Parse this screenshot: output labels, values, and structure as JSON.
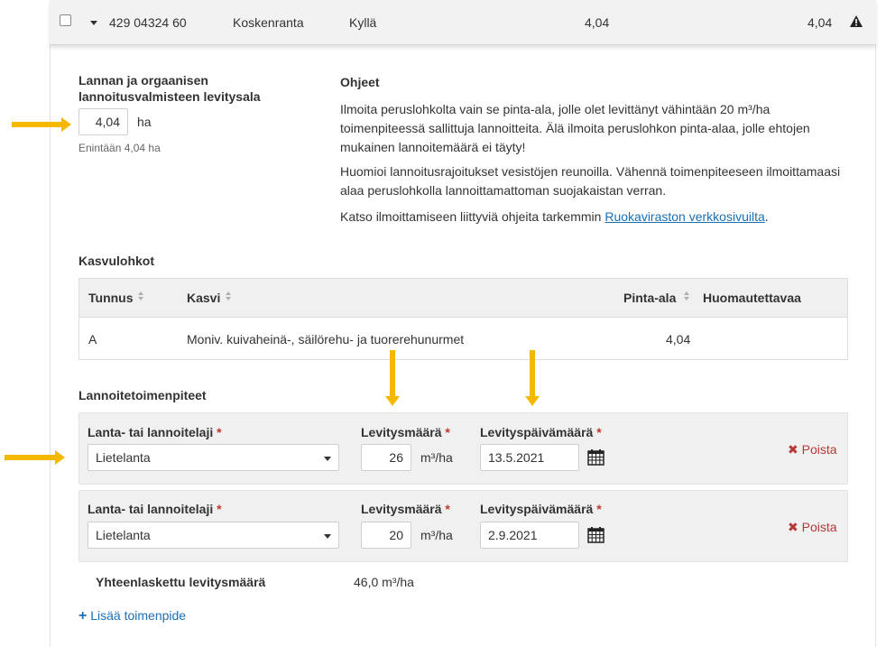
{
  "header_row": {
    "code": "429 04324 60",
    "name": "Koskenranta",
    "flag": "Kyllä",
    "area_a": "4,04",
    "area_b": "4,04",
    "warning_icon": "warning-triangle-icon"
  },
  "spread_area": {
    "label": "Lannan ja orgaanisen lannoitusvalmisteen levitysala",
    "value": "4,04",
    "unit": "ha",
    "hint": "Enintään 4,04 ha"
  },
  "instructions": {
    "title": "Ohjeet",
    "p1": "Ilmoita peruslohkolta vain se pinta-ala, jolle olet levittänyt vähintään 20 m³/ha toimenpiteessä sallittuja lannoitteita. Älä ilmoita peruslohkon pinta-alaa, jolle ehtojen mukainen lannoitemäärä ei täyty!",
    "p2": "Huomioi lannoitusrajoitukset vesistöjen reunoilla. Vähennä toimenpiteeseen ilmoittamaasi alaa peruslohkolla lannoittamattoman suojakaistan verran.",
    "p3_prefix": "Katso ilmoittamiseen liittyviä ohjeita tarkemmin ",
    "p3_link": "Ruokaviraston verkkosivuilta",
    "p3_suffix": "."
  },
  "kasvulohkot": {
    "title": "Kasvulohkot",
    "columns": [
      "Tunnus",
      "Kasvi",
      "Pinta-ala",
      "Huomautettavaa"
    ],
    "rows": [
      {
        "tunnus": "A",
        "kasvi": "Moniv. kuivaheinä-, säilörehu- ja tuorerehunurmet",
        "pinta_ala": "4,04",
        "huomautettavaa": ""
      }
    ]
  },
  "toimenpiteet": {
    "title": "Lannoitetoimenpiteet",
    "type_label": "Lanta- tai lannoitelaji",
    "amount_label": "Levitysmäärä",
    "date_label": "Levityspäivämäärä",
    "required_mark": "*",
    "unit": "m³/ha",
    "remove_label": "Poista",
    "items": [
      {
        "type": "Lietelanta",
        "amount": "26",
        "date": "13.5.2021"
      },
      {
        "type": "Lietelanta",
        "amount": "20",
        "date": "2.9.2021"
      }
    ]
  },
  "total": {
    "label": "Yhteenlaskettu levitysmäärä",
    "value": "46,0 m³/ha"
  },
  "add_action": {
    "label": "Lisää toimenpide"
  },
  "colors": {
    "highlight_arrow": "#f5b800",
    "link": "#1a6fb5",
    "remove": "#b23a3a",
    "required": "#c0392b"
  }
}
